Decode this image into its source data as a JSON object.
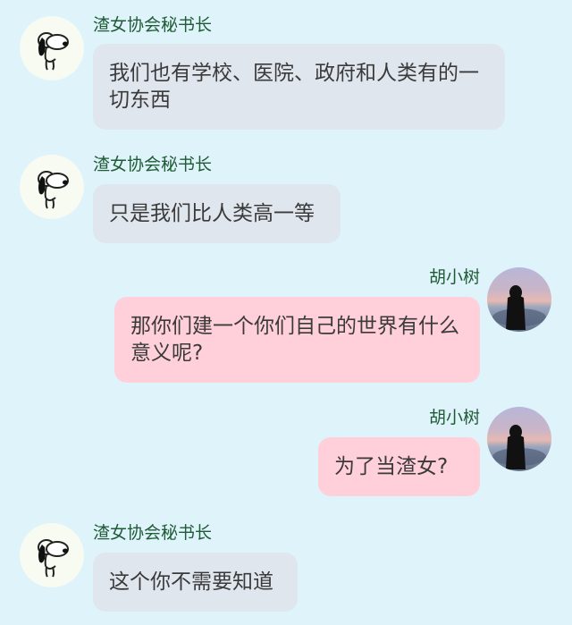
{
  "messages": [
    {
      "sender": "渣女协会秘书长",
      "side": "left",
      "text": "我们也有学校、医院、政府和人类有的一切东西",
      "avatar_icon": "snoopy-avatar-icon"
    },
    {
      "sender": "渣女协会秘书长",
      "side": "left",
      "text": "只是我们比人类高一等",
      "avatar_icon": "snoopy-avatar-icon"
    },
    {
      "sender": "胡小树",
      "side": "right",
      "text": "那你们建一个你们自己的世界有什么意义呢?",
      "avatar_icon": "sunset-girl-avatar-icon"
    },
    {
      "sender": "胡小树",
      "side": "right",
      "text": "为了当渣女?",
      "avatar_icon": "sunset-girl-avatar-icon"
    },
    {
      "sender": "渣女协会秘书长",
      "side": "left",
      "text": "这个你不需要知道",
      "avatar_icon": "snoopy-avatar-icon"
    }
  ],
  "colors": {
    "background": "#dff3fb",
    "left_bubble": "#e0e6ee",
    "right_bubble": "#ffd0d9",
    "sender_name": "#1f5b35",
    "message_text": "#3a3a3a"
  }
}
